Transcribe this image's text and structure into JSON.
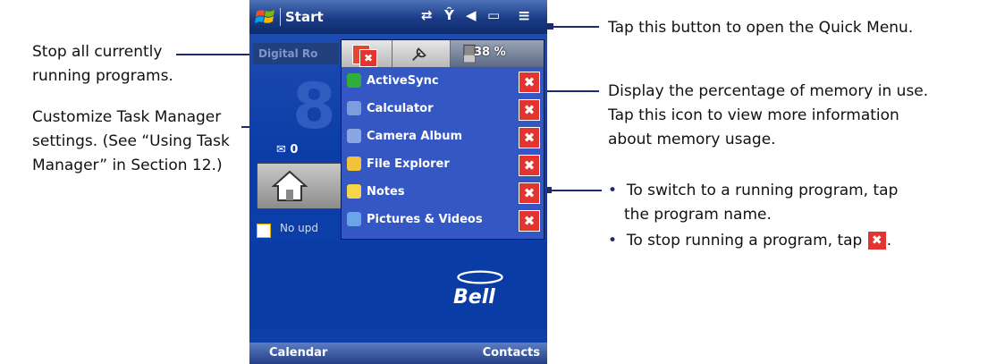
{
  "callouts": {
    "quick_menu": "Tap this button to open the Quick Menu.",
    "stop_all_1": "Stop all currently",
    "stop_all_2": "running programs.",
    "customize_1": "Customize Task Manager",
    "customize_2": "settings. (See “Using Task",
    "customize_3": "Manager” in Section 12.)",
    "memory_1": "Display the percentage of memory in use.",
    "memory_2": "Tap this icon to view more information",
    "memory_3": "about memory usage.",
    "bullet_symbol": "•",
    "switch_1": "To switch to a running program, tap",
    "switch_2": "the program name.",
    "stop_prefix": "To stop running a program, tap",
    "stop_suffix": "."
  },
  "phone": {
    "title": "Start",
    "status_icons": [
      "sync-icon",
      "signal-icon",
      "volume-icon",
      "battery-icon",
      "quick-menu-icon"
    ],
    "status_glyphs": [
      "⇄",
      "Ŷ",
      "◀",
      "▭",
      "≡"
    ],
    "home": {
      "plugin_label": "Digital Ro",
      "clock_digit": "8",
      "mail_count": "0",
      "no_updates": "No upd"
    },
    "carrier_logo": "Bell",
    "softkeys": {
      "left": "Calendar",
      "right": "Contacts"
    }
  },
  "task_manager": {
    "memory_percent": "38 %",
    "close_glyph": "✖",
    "programs": [
      {
        "name": "ActiveSync",
        "icon": "activesync-icon",
        "color": "#2fae3a"
      },
      {
        "name": "Calculator",
        "icon": "calculator-icon",
        "color": "#7f9cdc"
      },
      {
        "name": "Camera Album",
        "icon": "camera-album-icon",
        "color": "#8aa6e0"
      },
      {
        "name": "File Explorer",
        "icon": "file-explorer-icon",
        "color": "#f2c23c"
      },
      {
        "name": "Notes",
        "icon": "notes-icon",
        "color": "#f7d54a"
      },
      {
        "name": "Pictures & Videos",
        "icon": "pictures-videos-icon",
        "color": "#6aa5e8"
      }
    ]
  },
  "colors": {
    "callout_line": "#1f2a6b",
    "close_button": "#e3342f",
    "panel": "#3457c4"
  }
}
